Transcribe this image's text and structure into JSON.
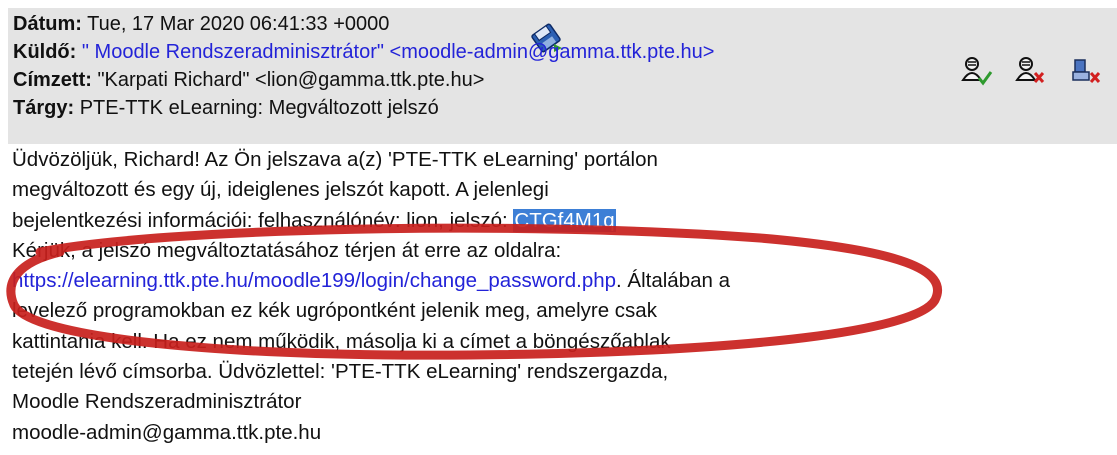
{
  "header": {
    "date_label": "Dátum:",
    "date_value": "Tue, 17 Mar 2020 06:41:33 +0000",
    "from_label": "Küldő:",
    "from_value": "\" Moodle Rendszeradminisztrátor\" <moodle-admin@gamma.ttk.pte.hu>",
    "to_label": "Címzett:",
    "to_value": "\"Karpati Richard\" <lion@gamma.ttk.pte.hu>",
    "subject_label": "Tárgy:",
    "subject_value": "PTE-TTK eLearning: Megváltozott jelszó"
  },
  "icons": {
    "save": "save-to-disk-icon",
    "add_sender": "add-sender-icon",
    "block_sender": "block-sender-icon",
    "delete_message": "delete-message-icon"
  },
  "body": {
    "line1": "Üdvözöljük, Richard! Az Ön jelszava a(z) 'PTE-TTK eLearning' portálon",
    "line2": "megváltozott és egy új, ideiglenes jelszót kapott. A jelenlegi",
    "line3_before": "bejelentkezési információi: felhasználónév: lion, jelszó: ",
    "line3_password": "CTGf4M1q",
    "line4": "Kérjük, a jelszó megváltoztatásához térjen át erre az oldalra:",
    "line5_link": "https://elearning.ttk.pte.hu/moodle199/login/change_password.php",
    "line5_after": ". Általában a",
    "line6": "levelező programokban ez kék ugrópontként jelenik meg, amelyre csak",
    "line7": "kattintania kell. Ha ez nem működik, másolja ki a címet a böngészőablak",
    "line8": "tetején lévő címsorba. Üdvözlettel: 'PTE-TTK eLearning' rendszergazda,",
    "line9": "Moodle Rendszeradminisztrátor",
    "line10": "moodle-admin@gamma.ttk.pte.hu"
  },
  "colors": {
    "header_bg": "#e4e4e4",
    "link": "#2323d8",
    "selection": "#3d7fd6",
    "annotation": "#c8201c"
  }
}
